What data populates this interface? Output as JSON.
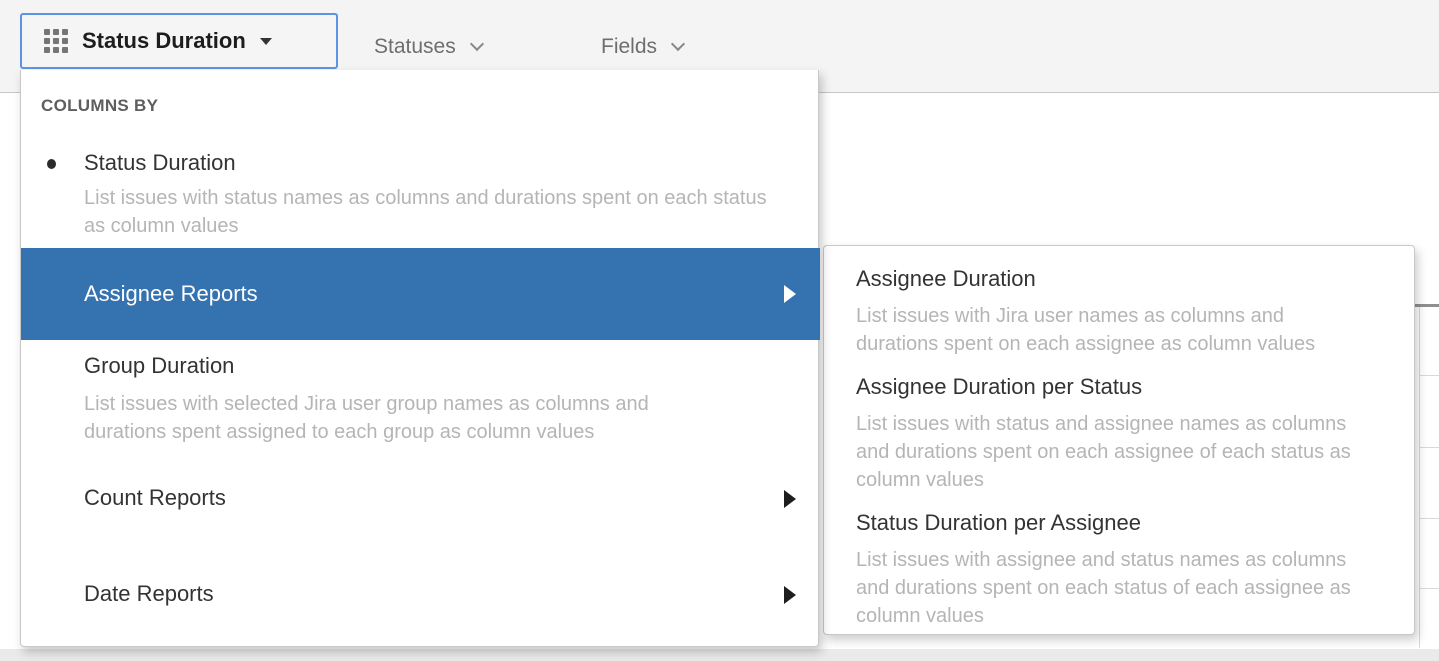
{
  "toolbar": {
    "columns_button": {
      "label": "Status Duration"
    },
    "statuses_label": "Statuses",
    "fields_label": "Fields"
  },
  "columns_menu": {
    "group_header": "COLUMNS BY",
    "items": [
      {
        "label": "Status Duration",
        "description": "List issues with status names as columns and durations spent on each status as column values",
        "selected": true
      },
      {
        "label": "Assignee Reports",
        "highlighted": true,
        "has_submenu": true
      },
      {
        "label": "Group Duration",
        "description": "List issues with selected Jira user group names as columns and durations spent assigned to each group as column values"
      },
      {
        "label": "Count Reports",
        "has_submenu": true
      },
      {
        "label": "Date Reports",
        "has_submenu": true
      }
    ]
  },
  "assignee_submenu": {
    "items": [
      {
        "label": "Assignee Duration",
        "description": "List issues with Jira user names as columns and durations spent on each assignee as column values"
      },
      {
        "label": "Assignee Duration per Status",
        "description": "List issues with status and assignee names as columns and durations spent on each assignee of each status as column values"
      },
      {
        "label": "Status Duration per Assignee",
        "description": "List issues with assignee and status names as columns and durations spent on each status of each assignee as column values"
      }
    ]
  },
  "colors": {
    "highlight_blue": "#3572b0",
    "focus_border_blue": "#5b93e5",
    "topbar_gray": "#f4f4f4",
    "description_gray": "#b5b5b5"
  }
}
